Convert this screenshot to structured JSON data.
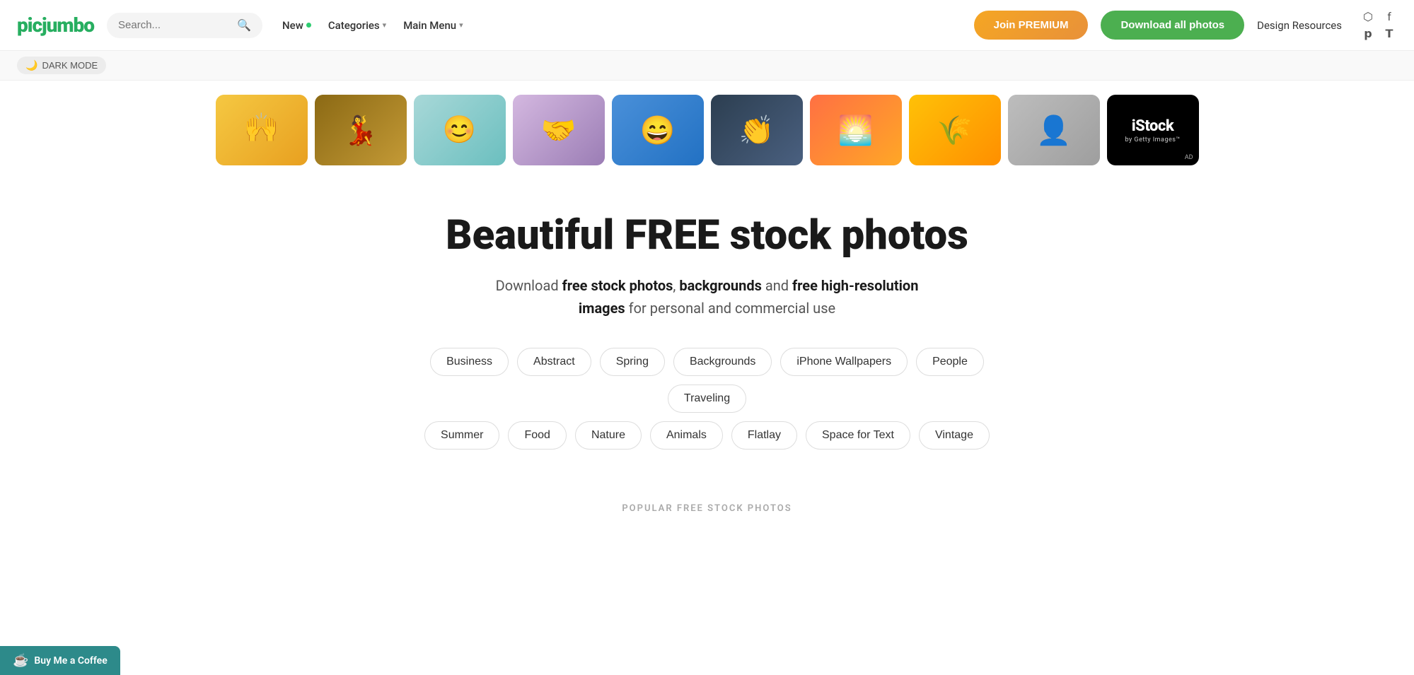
{
  "site": {
    "logo": "picjumbo",
    "logo_color": "#2ecc71"
  },
  "header": {
    "search_placeholder": "Search...",
    "nav_items": [
      {
        "label": "New",
        "has_dot": true,
        "has_chevron": false
      },
      {
        "label": "Categories",
        "has_dot": false,
        "has_chevron": true
      },
      {
        "label": "Main Menu",
        "has_dot": false,
        "has_chevron": true
      }
    ],
    "btn_premium": "Join PREMIUM",
    "btn_download": "Download all photos",
    "design_resources": "Design Resources"
  },
  "dark_mode": {
    "label": "DARK MODE"
  },
  "hero": {
    "title": "Beautiful FREE stock photos",
    "subtitle_plain1": "Download ",
    "subtitle_bold1": "free stock photos",
    "subtitle_plain2": ", ",
    "subtitle_bold2": "backgrounds",
    "subtitle_plain3": " and ",
    "subtitle_bold3": "free high-resolution images",
    "subtitle_plain4": " for personal and commercial use"
  },
  "tags": {
    "row1": [
      "Business",
      "Abstract",
      "Spring",
      "Backgrounds",
      "iPhone Wallpapers",
      "People",
      "Traveling"
    ],
    "row2": [
      "Summer",
      "Food",
      "Nature",
      "Animals",
      "Flatlay",
      "Space for Text",
      "Vintage"
    ]
  },
  "popular": {
    "label": "POPULAR FREE STOCK PHOTOS"
  },
  "buy_coffee": {
    "label": "Buy Me a Coffee"
  },
  "photos": [
    {
      "id": 1,
      "color_class": "ph-yellow",
      "emoji": "🙌"
    },
    {
      "id": 2,
      "color_class": "ph-brown",
      "emoji": "💃"
    },
    {
      "id": 3,
      "color_class": "ph-teal",
      "emoji": "😊"
    },
    {
      "id": 4,
      "color_class": "ph-purple",
      "emoji": "🤝"
    },
    {
      "id": 5,
      "color_class": "ph-blue",
      "emoji": "😄"
    },
    {
      "id": 6,
      "color_class": "ph-dark",
      "emoji": "👏"
    },
    {
      "id": 7,
      "color_class": "ph-sunset",
      "emoji": "🌅"
    },
    {
      "id": 8,
      "color_class": "ph-golden",
      "emoji": "🌾"
    },
    {
      "id": 9,
      "color_class": "ph-gray",
      "emoji": "👤"
    }
  ],
  "istock": {
    "title": "iStock",
    "subtitle": "by Getty Images™",
    "ad_label": "AD"
  },
  "social": {
    "icons": [
      "instagram",
      "facebook",
      "pinterest",
      "twitter"
    ]
  }
}
